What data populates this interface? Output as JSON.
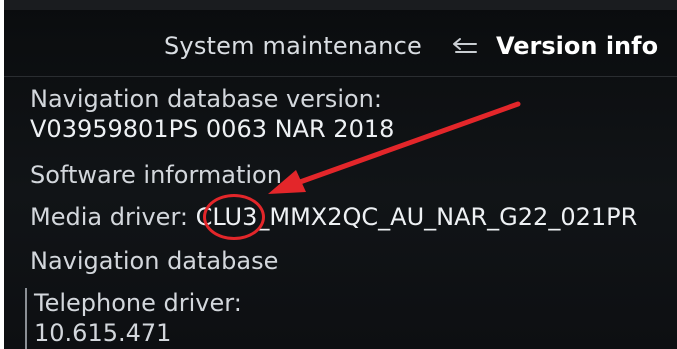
{
  "header": {
    "parent": "System maintenance",
    "back_icon": "return-arrow-icon",
    "current": "Version info"
  },
  "items": {
    "nav_db_version_label": "Navigation database version:",
    "nav_db_version_value": "V03959801PS 0063 NAR 2018",
    "software_info": "Software information",
    "media_driver_label": "Media driver: ",
    "media_driver_value": "CLU3_MMX2QC_AU_NAR_G22_021PR",
    "navigation_database": "Navigation database",
    "telephone_driver_label": "Telephone driver:",
    "telephone_driver_value": "10.615.471"
  },
  "colors": {
    "annotation": "#e3262a",
    "screen_bg": "#0d0f12"
  }
}
